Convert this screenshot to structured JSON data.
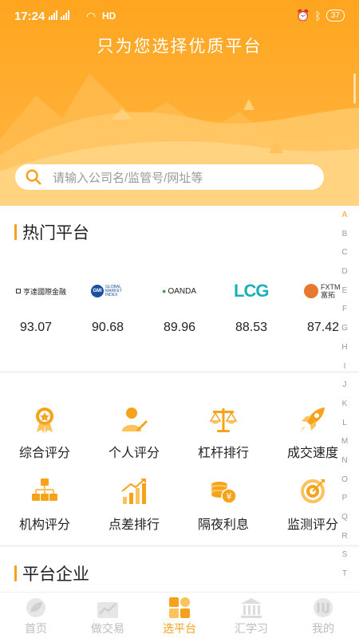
{
  "status": {
    "time": "17:24",
    "sig1": "4G",
    "sig2": "4G",
    "hd": "HD",
    "battery": "37"
  },
  "header": {
    "title": "只为您选择优质平台"
  },
  "search": {
    "placeholder": "请输入公司名/监管号/网址等"
  },
  "hot": {
    "title": "热门平台",
    "brands": [
      {
        "name": "亨達國際金融",
        "score": "93.07"
      },
      {
        "name": "GMI",
        "score": "90.68"
      },
      {
        "name": "OANDA",
        "score": "89.96"
      },
      {
        "name": "LCG",
        "score": "88.53"
      },
      {
        "name": "FXTM富拓",
        "score": "87.42"
      }
    ],
    "gmi_sub": [
      "GLOBAL",
      "MARKET",
      "INDEX"
    ],
    "fxtm_cn": "富拓",
    "fxtm_en": "FXTM"
  },
  "categories": [
    {
      "label": "综合评分",
      "icon": "medal-icon"
    },
    {
      "label": "个人评分",
      "icon": "person-pen-icon"
    },
    {
      "label": "杠杆排行",
      "icon": "scale-icon"
    },
    {
      "label": "成交速度",
      "icon": "rocket-icon"
    },
    {
      "label": "机构评分",
      "icon": "org-chart-icon"
    },
    {
      "label": "点差排行",
      "icon": "trend-bars-icon"
    },
    {
      "label": "隔夜利息",
      "icon": "coins-icon"
    },
    {
      "label": "监测评分",
      "icon": "target-icon"
    }
  ],
  "company": {
    "title": "平台企业"
  },
  "alphabet": [
    "A",
    "B",
    "C",
    "D",
    "E",
    "F",
    "G",
    "H",
    "I",
    "J",
    "K",
    "L",
    "M",
    "N",
    "O",
    "P",
    "Q",
    "R",
    "S",
    "T"
  ],
  "nav": [
    {
      "label": "首页",
      "icon": "home-leaf-icon",
      "active": false
    },
    {
      "label": "做交易",
      "icon": "chart-icon",
      "active": false
    },
    {
      "label": "选平台",
      "icon": "grid-icon",
      "active": true
    },
    {
      "label": "汇学习",
      "icon": "bank-icon",
      "active": false
    },
    {
      "label": "我的",
      "icon": "profile-icon",
      "active": false
    }
  ],
  "colors": {
    "accent": "#f5a11e",
    "header": "#fea92b"
  }
}
